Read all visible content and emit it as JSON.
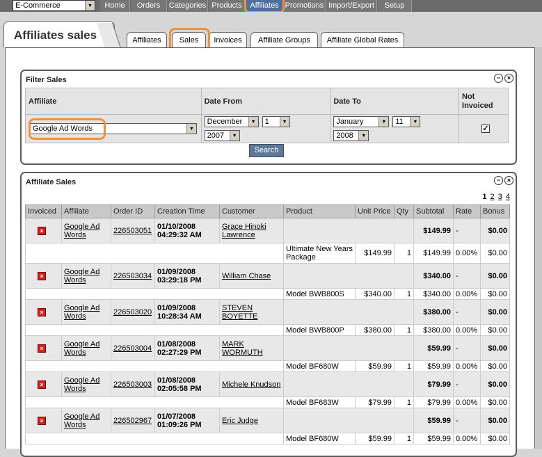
{
  "store_select": {
    "value": "E-Commerce"
  },
  "nav": [
    {
      "label": "Home"
    },
    {
      "label": "Orders"
    },
    {
      "label": "Categories"
    },
    {
      "label": "Products"
    },
    {
      "label": "Affiliates"
    },
    {
      "label": "Promotions"
    },
    {
      "label": "Import/Export"
    },
    {
      "label": "Setup"
    }
  ],
  "page_title": "Affiliates sales",
  "subtabs": [
    {
      "label": "Affiliates"
    },
    {
      "label": "Sales"
    },
    {
      "label": "Invoices"
    },
    {
      "label": "Affiliate Groups"
    },
    {
      "label": "Affiliate Global Rates"
    }
  ],
  "filter": {
    "title": "Filter Sales",
    "headers": {
      "affiliate": "Affiliate",
      "date_from": "Date From",
      "date_to": "Date To",
      "not_invoiced": "Not Invoiced"
    },
    "affiliate_value": "Google Ad Words",
    "from_month": "December",
    "from_day": "1",
    "from_year": "2007",
    "to_month": "January",
    "to_day": "11",
    "to_year": "2008",
    "not_invoiced_checked": "✓",
    "search_label": "Search"
  },
  "sales": {
    "title": "Affiliate Sales",
    "pages": [
      "1",
      "2",
      "3",
      "4"
    ],
    "columns": [
      "Invoiced",
      "Affiliate",
      "Order ID",
      "Creation Time",
      "Customer",
      "Product",
      "Unit Price",
      "Qty",
      "Subtotal",
      "Rate",
      "Bonus"
    ],
    "rows": [
      {
        "affiliate": "Google Ad Words",
        "order_id": "226503051",
        "date": "01/10/2008",
        "time": "04:29:32 AM",
        "customer": "Grace Hinoki Lawrence",
        "subtotal": "$149.99",
        "rate": "-",
        "bonus": "$0.00",
        "item": {
          "product": "Ultimate New Years Package",
          "unit_price": "$149.99",
          "qty": "1",
          "subtotal": "$149.99",
          "rate": "0.00%",
          "bonus": "$0.00"
        }
      },
      {
        "affiliate": "Google Ad Words",
        "order_id": "226503034",
        "date": "01/09/2008",
        "time": "03:29:18 PM",
        "customer": "William Chase",
        "subtotal": "$340.00",
        "rate": "-",
        "bonus": "$0.00",
        "item": {
          "product": "Model BWB800S",
          "unit_price": "$340.00",
          "qty": "1",
          "subtotal": "$340.00",
          "rate": "0.00%",
          "bonus": "$0.00"
        }
      },
      {
        "affiliate": "Google Ad Words",
        "order_id": "226503020",
        "date": "01/09/2008",
        "time": "10:28:34 AM",
        "customer": "STEVEN BOYETTE",
        "subtotal": "$380.00",
        "rate": "-",
        "bonus": "$0.00",
        "item": {
          "product": "Model BWB800P",
          "unit_price": "$380.00",
          "qty": "1",
          "subtotal": "$380.00",
          "rate": "0.00%",
          "bonus": "$0.00"
        }
      },
      {
        "affiliate": "Google Ad Words",
        "order_id": "226503004",
        "date": "01/08/2008",
        "time": "02:27:29 PM",
        "customer": "MARK WORMUTH",
        "subtotal": "$59.99",
        "rate": "-",
        "bonus": "$0.00",
        "item": {
          "product": "Model BF680W",
          "unit_price": "$59.99",
          "qty": "1",
          "subtotal": "$59.99",
          "rate": "0.00%",
          "bonus": "$0.00"
        }
      },
      {
        "affiliate": "Google Ad Words",
        "order_id": "226503003",
        "date": "01/08/2008",
        "time": "02:05:58 PM",
        "customer": "Michele Knudson",
        "subtotal": "$79.99",
        "rate": "-",
        "bonus": "$0.00",
        "item": {
          "product": "Model BF683W",
          "unit_price": "$79.99",
          "qty": "1",
          "subtotal": "$79.99",
          "rate": "0.00%",
          "bonus": "$0.00"
        }
      },
      {
        "affiliate": "Google Ad Words",
        "order_id": "226502967",
        "date": "01/07/2008",
        "time": "01:09:26 PM",
        "customer": "Eric Judge",
        "subtotal": "$59.99",
        "rate": "-",
        "bonus": "$0.00",
        "item": {
          "product": "Model BF680W",
          "unit_price": "$59.99",
          "qty": "1",
          "subtotal": "$59.99",
          "rate": "0.00%",
          "bonus": "$0.00"
        }
      }
    ]
  }
}
